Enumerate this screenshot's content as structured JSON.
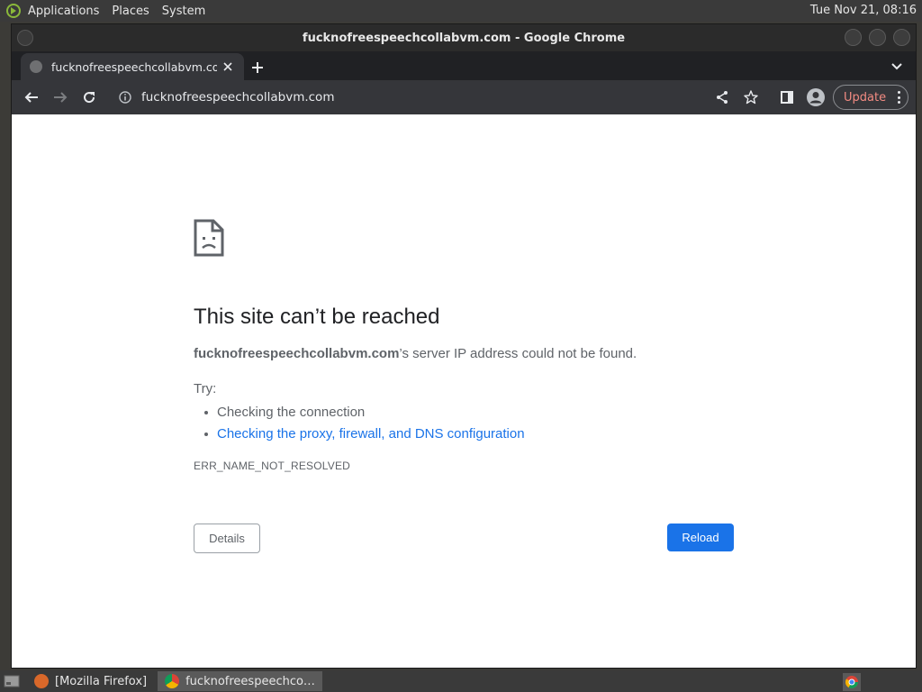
{
  "top_panel": {
    "menus": [
      "Applications",
      "Places",
      "System"
    ],
    "clock": "Tue Nov 21, 08:16"
  },
  "window": {
    "title": "fucknofreespeechcollabvm.com - Google Chrome"
  },
  "tab": {
    "title": "fucknofreespeechcollabvm.com",
    "close": "✕"
  },
  "toolbar": {
    "url": "fucknofreespeechcollabvm.com",
    "update_label": "Update"
  },
  "error_page": {
    "heading": "This site can’t be reached",
    "host": "fucknofreespeechcollabvm.com",
    "desc_suffix": "’s server IP address could not be found.",
    "try_label": "Try:",
    "suggestions": [
      "Checking the connection",
      "Checking the proxy, firewall, and DNS configuration"
    ],
    "error_code": "ERR_NAME_NOT_RESOLVED",
    "details_label": "Details",
    "reload_label": "Reload"
  },
  "taskbar": {
    "tasks": [
      "[Mozilla Firefox]",
      "fucknofreespeechco…"
    ]
  },
  "colors": {
    "link": "#1a73e8",
    "reload_bg": "#1a73e8",
    "update_text": "#f28b82"
  }
}
